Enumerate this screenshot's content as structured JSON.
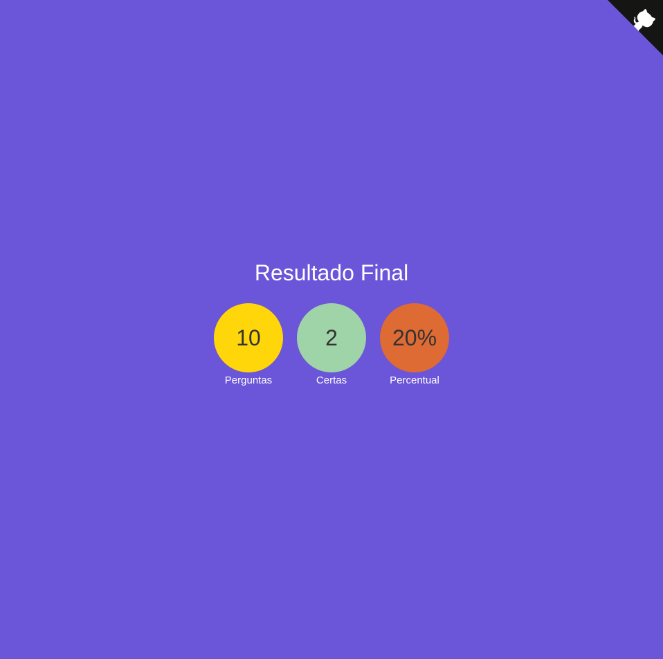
{
  "page": {
    "background": "#6b55d8"
  },
  "corner": {
    "icon": "github-octocat-icon",
    "background": "#151513",
    "foreground": "#ffffff"
  },
  "result": {
    "title": "Resultado Final",
    "stats": [
      {
        "value": "10",
        "label": "Perguntas",
        "color": "#ffd60a"
      },
      {
        "value": "2",
        "label": "Certas",
        "color": "#9fd3a8"
      },
      {
        "value": "20%",
        "label": "Percentual",
        "color": "#de6a34"
      }
    ]
  }
}
